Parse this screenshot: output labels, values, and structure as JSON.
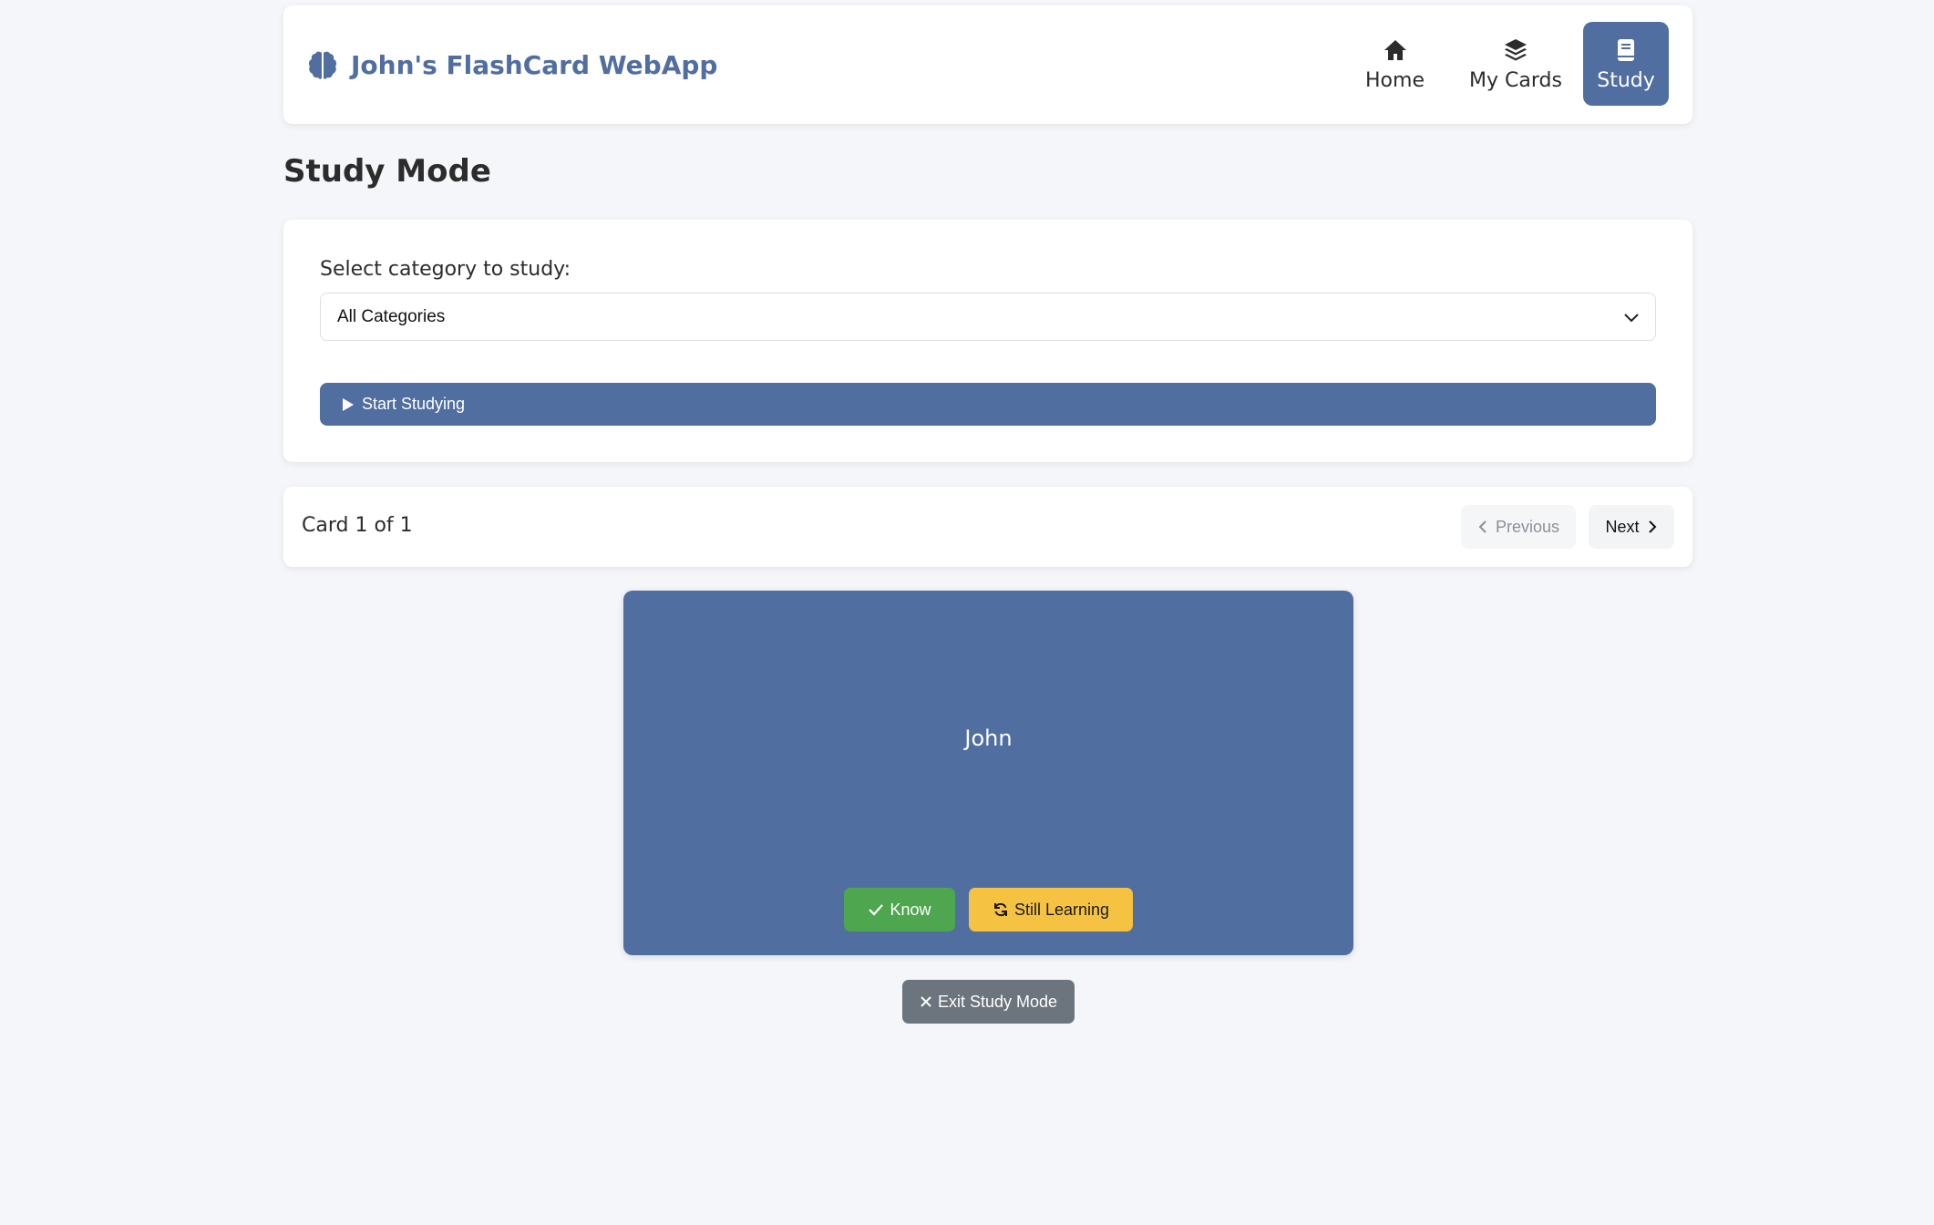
{
  "header": {
    "brand_icon": "brain-icon",
    "title": "John's FlashCard WebApp",
    "nav": [
      {
        "label": "Home",
        "icon": "home-icon"
      },
      {
        "label": "My Cards",
        "icon": "layers-icon"
      },
      {
        "label": "Study",
        "icon": "book-icon",
        "active": true
      }
    ]
  },
  "page": {
    "title": "Study Mode"
  },
  "category_panel": {
    "label": "Select category to study:",
    "selected": "All Categories",
    "start_label": "Start Studying"
  },
  "counter_bar": {
    "counter_text": "Card 1 of 1",
    "previous_label": "Previous",
    "next_label": "Next"
  },
  "card": {
    "front_text": "John",
    "know_label": "Know",
    "still_learning_label": "Still Learning"
  },
  "exit_label": "Exit Study Mode",
  "colors": {
    "brand": "#516ea0",
    "know": "#4ea64e",
    "still_learning": "#f5c242",
    "exit": "#6c757d",
    "background": "#f5f6f9"
  }
}
